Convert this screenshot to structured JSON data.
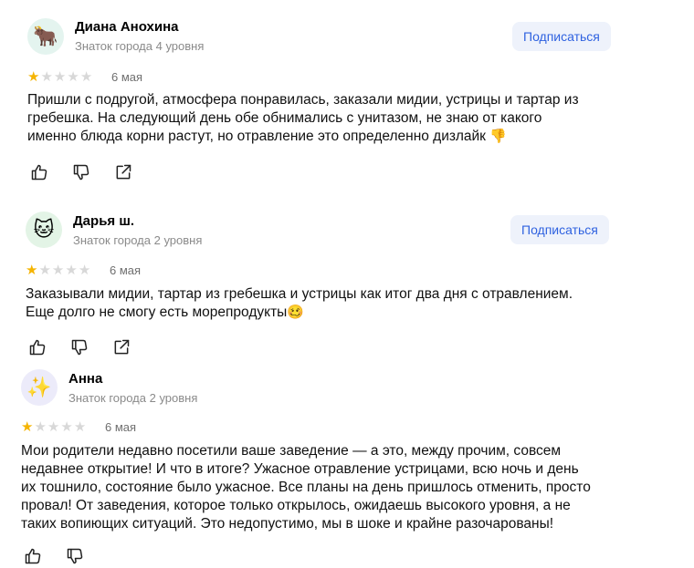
{
  "reviews": [
    {
      "avatar_icon": "🐂",
      "avatar_bg": "#e4f4ef",
      "name": "Диана Анохина",
      "level": "Знаток города 4 уровня",
      "subscribe_label": "Подписаться",
      "rating": 1,
      "rating_max": 5,
      "date": "6 мая",
      "text_lines": [
        "Пришли с подругой, атмосфера понравилась, заказали мидии, устрицы и тартар из",
        "гребешка. На следующий день обе обнимались с унитазом, не знаю от какого",
        "именно блюда корни растут, но отравление это определенно дизлайк"
      ],
      "trailing_emoji": "👎"
    },
    {
      "avatar_icon": "🐱",
      "avatar_bg": "#e3f4e6",
      "name": "Дарья ш.",
      "level": "Знаток города 2 уровня",
      "subscribe_label": "Подписаться",
      "rating": 1,
      "rating_max": 5,
      "date": "6 мая",
      "text_lines": [
        "Заказывали мидии, тартар из гребешка и устрицы как итог два дня с отравлением.",
        "Еще долго не смогу есть морепродукты"
      ],
      "trailing_emoji": "🥴"
    },
    {
      "avatar_icon": "✨",
      "avatar_bg": "#ecebfa",
      "name": "Анна",
      "level": "Знаток города 2 уровня",
      "rating": 1,
      "rating_max": 5,
      "date": "6 мая",
      "text_lines": [
        "Мои родители недавно посетили ваше заведение — а это, между прочим, совсем",
        "недавнее открытие! И что в итоге? Ужасное отравление устрицами, всю ночь и день",
        "их тошнило, состояние было ужасное. Все планы на день пришлось отменить, просто",
        "провал! От заведения, которое только открылось, ожидаешь высокого уровня, а не",
        "таких вопиющих ситуаций. Это недопустимо, мы в шоке и крайне разочарованы!"
      ]
    }
  ],
  "colors": {
    "star_filled": "#f5b400",
    "star_empty": "#d8d8d8",
    "subscribe_text": "#2f62e0",
    "subscribe_bg": "#eef2fb"
  },
  "icons": [
    "like-icon",
    "dislike-icon",
    "share-icon"
  ]
}
